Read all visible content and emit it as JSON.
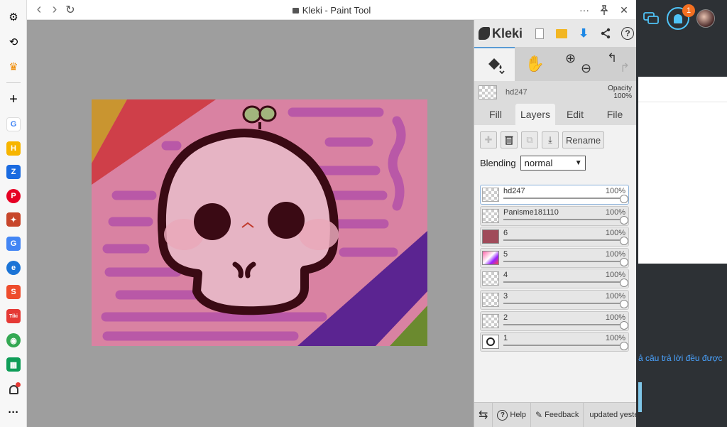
{
  "window": {
    "title": "Kleki - Paint Tool",
    "nav_back": "‹",
    "nav_forward": "›",
    "reload": "↻",
    "more": "···",
    "pin": "⚲",
    "close": "✕"
  },
  "sidebar": {
    "items": [
      {
        "name": "settings-icon",
        "glyph": "⚙"
      },
      {
        "name": "history-icon",
        "glyph": "⟲"
      },
      {
        "name": "crown-icon",
        "glyph": "♛"
      },
      {
        "name": "add-icon",
        "glyph": "+"
      },
      {
        "name": "app-google",
        "glyph": "G"
      },
      {
        "name": "app-h",
        "glyph": "H"
      },
      {
        "name": "app-zalo",
        "glyph": "Z"
      },
      {
        "name": "app-pinterest",
        "glyph": "P"
      },
      {
        "name": "app-translate",
        "glyph": "T"
      },
      {
        "name": "app-translate-2",
        "glyph": "G"
      },
      {
        "name": "app-edge",
        "glyph": "e"
      },
      {
        "name": "app-shopee",
        "glyph": "S"
      },
      {
        "name": "app-tiki",
        "glyph": "Tiki"
      },
      {
        "name": "app-chrome",
        "glyph": "◉"
      },
      {
        "name": "app-sheets",
        "glyph": "▦"
      },
      {
        "name": "notifications-icon",
        "glyph": "🔔"
      },
      {
        "name": "more-icon",
        "glyph": "···"
      }
    ]
  },
  "panel": {
    "brand": "Kleki",
    "layer_name": "hd247",
    "opacity_label": "Opacity",
    "opacity_value": "100%",
    "tabs": [
      "Fill",
      "Layers",
      "Edit",
      "File"
    ],
    "active_tab": "Layers",
    "rename_label": "Rename",
    "blending_label": "Blending",
    "blending_value": "normal",
    "layers": [
      {
        "name": "hd247",
        "opacity": "100%",
        "selected": true
      },
      {
        "name": "Panisme181110",
        "opacity": "100%",
        "selected": false
      },
      {
        "name": "6",
        "opacity": "100%",
        "selected": false
      },
      {
        "name": "5",
        "opacity": "100%",
        "selected": false
      },
      {
        "name": "4",
        "opacity": "100%",
        "selected": false
      },
      {
        "name": "3",
        "opacity": "100%",
        "selected": false
      },
      {
        "name": "2",
        "opacity": "100%",
        "selected": false
      },
      {
        "name": "1",
        "opacity": "100%",
        "selected": false
      }
    ],
    "footer": {
      "help": "Help",
      "feedback": "Feedback",
      "updated_line1": "updated",
      "updated_line2": "yesterday"
    }
  },
  "background_page": {
    "notification_count": "1",
    "link_text": "ả câu trả lời đều được"
  },
  "colors": {
    "accent_blue": "#5a9bd5",
    "canvas_pink": "#d982a2",
    "badge_orange": "#f37021"
  }
}
